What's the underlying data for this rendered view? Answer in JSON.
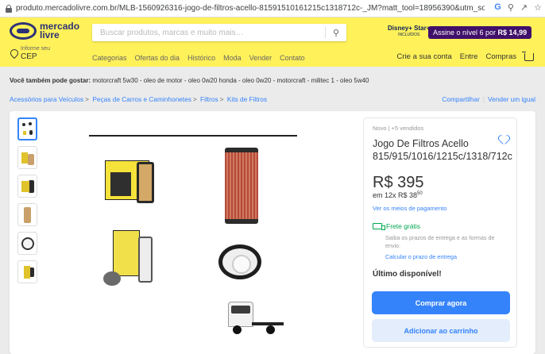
{
  "browser": {
    "url": "produto.mercadolivre.com.br/MLB-1560926316-jogo-de-filtros-acello-81591510161215c1318712c-_JM?matt_tool=18956390&utm_source=google_sho...",
    "icons": [
      "G",
      "search-icon",
      "share-icon",
      "star-icon"
    ]
  },
  "header": {
    "logo_line1": "mercado",
    "logo_line2": "livre",
    "search_placeholder": "Buscar produtos, marcas e muito mais…",
    "disney_logo": "Disney+ Star+",
    "disney_sub": "INCLUÍDOS",
    "promo_prefix": "Assine o nível 6 por ",
    "promo_price": "R$ 14,99",
    "cep_small": "Informe seu",
    "cep_big": "CEP",
    "nav": [
      "Categorias",
      "Ofertas do dia",
      "Histórico",
      "Moda",
      "Vender",
      "Contato"
    ],
    "right_nav": [
      "Crie a sua conta",
      "Entre",
      "Compras"
    ]
  },
  "related": {
    "label": "Você também pode gostar:",
    "items": "motorcraft 5w30 - oleo de motor - oleo 0w20 honda - oleo 0w20 - motorcraft - militec 1 - oleo 5w40"
  },
  "breadcrumb": [
    "Acessórios para Veículos",
    "Peças de Carros e Caminhonetes",
    "Filtros",
    "Kits de Filtros"
  ],
  "share": {
    "share": "Compartilhar",
    "sell": "Vender um igual"
  },
  "product": {
    "condition": "Novo  |  +5 vendidos",
    "title": "Jogo De Filtros Acello 815/915/1016/1215c/1318/712c",
    "price": "R$ 395",
    "installment_text": "em 12x R$ 38",
    "installment_cents": "50",
    "payment_link": "Ver os meios de pagamento",
    "free_shipping": "Frete grátis",
    "shipping_info": "Saiba os prazos de entrega e as formas de envio.",
    "calc_link": "Calcular o prazo de entrega",
    "stock": "Último disponível!",
    "buy_now": "Comprar agora",
    "add_cart": "Adicionar ao carrinho"
  },
  "colors": {
    "header_bg": "#fff159",
    "accent": "#3483fa",
    "success": "#00a650",
    "promo": "#40106a"
  }
}
